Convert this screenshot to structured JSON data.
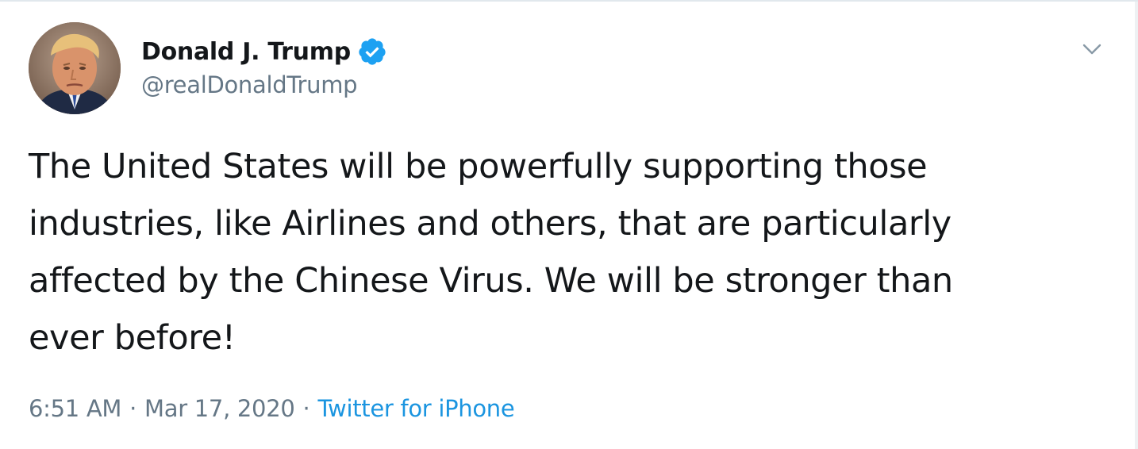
{
  "user": {
    "display_name": "Donald J. Trump",
    "handle": "@realDonaldTrump",
    "verified_icon": "verified-badge-icon",
    "avatar_icon": "profile-photo"
  },
  "tweet": {
    "text_lines": [
      "The United States will be powerfully supporting those",
      "industries, like Airlines and others, that are particularly",
      "affected by the Chinese Virus. We will be stronger than",
      "ever before!"
    ]
  },
  "meta": {
    "time": "6:51 AM",
    "separator": "·",
    "date": "Mar 17, 2020",
    "source": "Twitter for iPhone"
  },
  "controls": {
    "more_icon": "chevron-down-icon"
  },
  "colors": {
    "text_primary": "#14171a",
    "text_secondary": "#657786",
    "link": "#1b95e0",
    "verified": "#1da1f2"
  }
}
